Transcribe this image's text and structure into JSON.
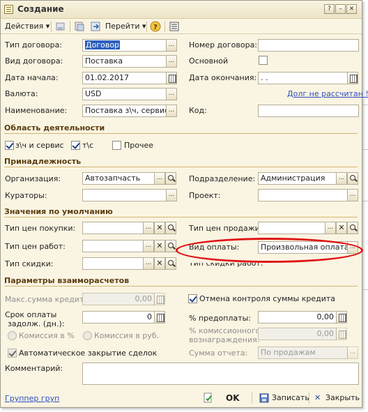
{
  "window": {
    "title": "Создание"
  },
  "toolbar": {
    "actions_label": "Действия",
    "goto_label": "Перейти"
  },
  "main": {
    "contract_type": {
      "label": "Тип договора:",
      "value": "Договор"
    },
    "contract_kind": {
      "label": "Вид договора:",
      "value": "Поставка"
    },
    "start_date": {
      "label": "Дата начала:",
      "value": "01.02.2017"
    },
    "currency": {
      "label": "Валюта:",
      "value": "USD"
    },
    "name": {
      "label": "Наименование:",
      "value": "Поставка з\\ч, сервис и"
    },
    "contract_number": {
      "label": "Номер договора:",
      "value": ""
    },
    "primary": {
      "label": "Основной",
      "checked": false
    },
    "end_date": {
      "label": "Дата окончания:",
      "value": " .  ."
    },
    "debt_link": "Долг не рассчитан !",
    "code": {
      "label": "Код:",
      "value": ""
    }
  },
  "activity": {
    "title": "Область деятельности",
    "items": [
      {
        "label": "з\\ч и сервис",
        "checked": true
      },
      {
        "label": "т\\с",
        "checked": true
      },
      {
        "label": "Прочее",
        "checked": false
      }
    ]
  },
  "belonging": {
    "title": "Принадлежность",
    "organization": {
      "label": "Организация:",
      "value": "Автозапчасть"
    },
    "curators": {
      "label": "Кураторы:",
      "value": ""
    },
    "department": {
      "label": "Подразделение:",
      "value": "Администрация"
    },
    "project": {
      "label": "Проект:",
      "value": ""
    }
  },
  "defaults": {
    "title": "Значения по умолчанию",
    "purchase_price_type": {
      "label": "Тип цен покупки:",
      "value": ""
    },
    "work_price_type": {
      "label": "Тип цен работ:",
      "value": ""
    },
    "discount_type": {
      "label": "Тип скидки:",
      "value": ""
    },
    "sale_price_type": {
      "label": "Тип цен продажи:",
      "value": ""
    },
    "payment_kind": {
      "label": "Вид оплаты:",
      "value": "Произвольная оплата"
    },
    "work_discount_type": {
      "label": "Тип скидки работ:"
    }
  },
  "settlement": {
    "title": "Параметры взаиморасчетов",
    "max_credit": {
      "label": "Макс.сумма кредита:",
      "value": "0,00"
    },
    "payment_term": {
      "label_line1": "Срок оплаты",
      "label_line2": "задолж. (дн.):",
      "value": "0"
    },
    "commission_pct": "Комиссия в %",
    "commission_rub": "Комиссия в руб.",
    "auto_close": {
      "label": "Автоматическое закрытие сделок",
      "checked": true
    },
    "cancel_credit_control": {
      "label": "Отмена контроля суммы кредита",
      "checked": true
    },
    "prepayment": {
      "label": "% предоплаты:",
      "value": "0,00"
    },
    "commission_reward": {
      "label_line1": "% комиссионного",
      "label_line2": "вознаграждения:",
      "value": "0,00"
    },
    "report_sum": {
      "label": "Сумма отчета:",
      "value": "По продажам"
    }
  },
  "comment": {
    "label": "Комментарий:",
    "value": ""
  },
  "footer": {
    "group_link": "Группер груп",
    "ok_label": "OK",
    "save_label": "Записать",
    "close_label": "Закрыть"
  },
  "colors": {
    "highlight_ellipse": "#e01414",
    "link": "#2f4fbf",
    "section": "#5a3d10",
    "background": "#faf4e2"
  }
}
